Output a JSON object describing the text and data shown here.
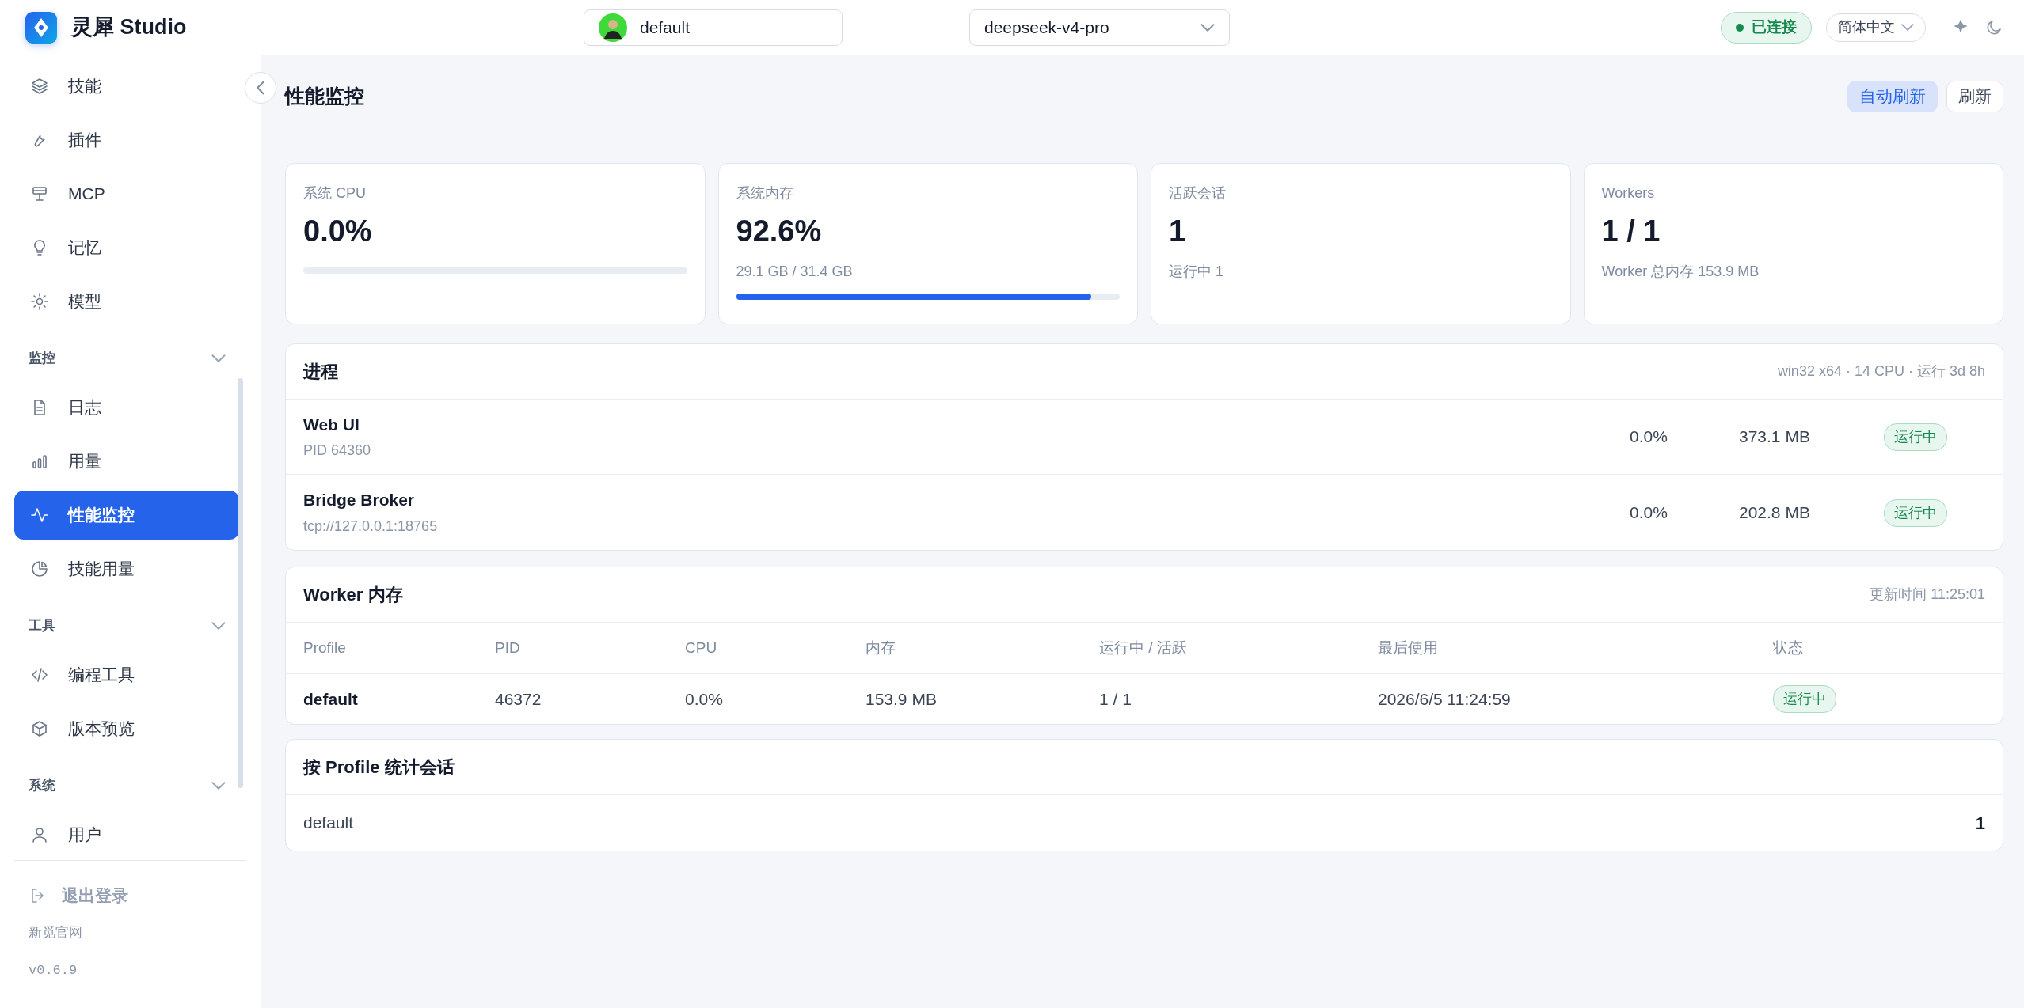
{
  "app": {
    "title": "灵犀 Studio"
  },
  "header": {
    "profile": "default",
    "model": "deepseek-v4-pro",
    "connection": {
      "label": "已连接",
      "connected": true
    },
    "language": "简体中文"
  },
  "sidebar": {
    "groups": [
      {
        "items": [
          {
            "label": "技能",
            "selected": false
          },
          {
            "label": "插件",
            "selected": false
          },
          {
            "label": "MCP",
            "selected": false
          },
          {
            "label": "记忆",
            "selected": false
          },
          {
            "label": "模型",
            "selected": false
          }
        ]
      },
      {
        "title": "监控",
        "expanded": true,
        "items": [
          {
            "label": "日志",
            "selected": false
          },
          {
            "label": "用量",
            "selected": false
          },
          {
            "label": "性能监控",
            "selected": true
          },
          {
            "label": "技能用量",
            "selected": false
          }
        ]
      },
      {
        "title": "工具",
        "expanded": true,
        "items": [
          {
            "label": "编程工具",
            "selected": false
          },
          {
            "label": "版本预览",
            "selected": false
          }
        ]
      },
      {
        "title": "系统",
        "expanded": true,
        "items": [
          {
            "label": "用户",
            "selected": false
          }
        ]
      }
    ],
    "logout": "退出登录",
    "site_link": "新觅官网",
    "version": "v0.6.9"
  },
  "page": {
    "title": "性能监控",
    "buttons": [
      {
        "label": "自动刷新",
        "on": true
      },
      {
        "label": "刷新",
        "on": false
      }
    ]
  },
  "stats": [
    {
      "label": "系统 CPU",
      "value": "0.0%",
      "level": 0.0
    },
    {
      "label": "系统内存",
      "value": "92.6%",
      "sub": "29.1 GB / 31.4 GB",
      "level": 0.926
    },
    {
      "label": "活跃会话",
      "value": "1",
      "sub": "运行中 1"
    },
    {
      "label": "Workers",
      "value": "1 / 1",
      "sub": "Worker 总内存 153.9 MB"
    }
  ],
  "processes": {
    "title": "进程",
    "meta": "win32 x64 · 14 CPU · 运行 3d 8h",
    "rows": [
      {
        "name": "Web UI",
        "detail": "PID 64360",
        "cpu": "0.0%",
        "memory": "373.1 MB",
        "status": "运行中"
      },
      {
        "name": "Bridge Broker",
        "detail": "tcp://127.0.0.1:18765",
        "cpu": "0.0%",
        "memory": "202.8 MB",
        "status": "运行中"
      }
    ]
  },
  "worker_memory": {
    "title": "Worker 内存",
    "updated": "更新时间 11:25:01",
    "columns": [
      "Profile",
      "PID",
      "CPU",
      "内存",
      "运行中 / 活跃",
      "最后使用",
      "状态"
    ],
    "rows": [
      [
        "default",
        "46372",
        "0.0%",
        "153.9 MB",
        "1 / 1",
        "2026/6/5 11:24:59",
        "运行中"
      ]
    ]
  },
  "sessions_by_profile": {
    "title": "按 Profile 统计会话",
    "rows": [
      {
        "profile": "default",
        "count": "1"
      }
    ]
  }
}
